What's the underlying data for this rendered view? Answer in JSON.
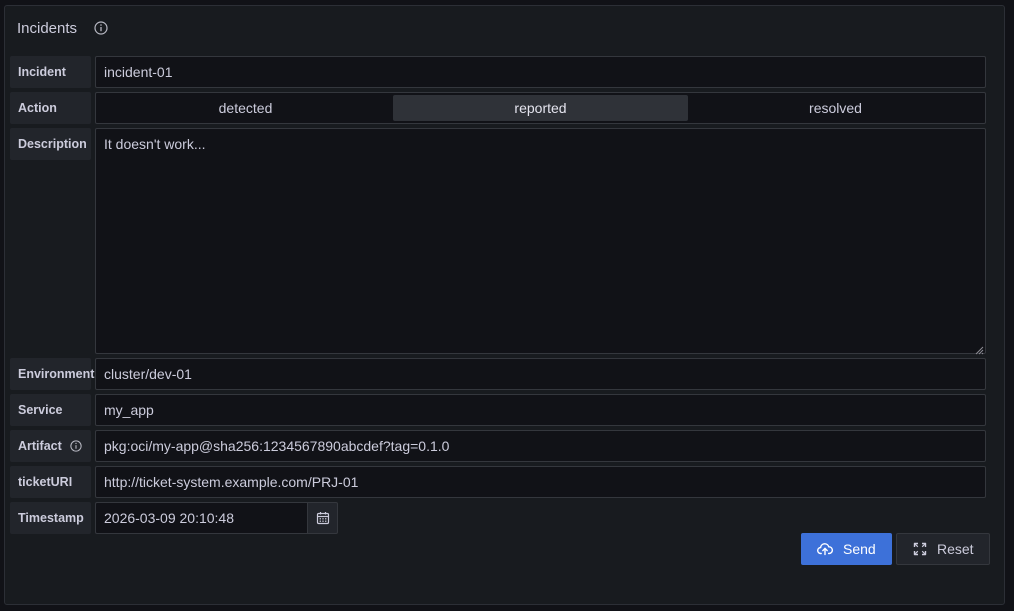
{
  "panel": {
    "title": "Incidents"
  },
  "form": {
    "incident": {
      "label": "Incident",
      "value": "incident-01"
    },
    "action": {
      "label": "Action",
      "options": [
        "detected",
        "reported",
        "resolved"
      ],
      "selected": "reported"
    },
    "description": {
      "label": "Description",
      "value": "It doesn't work..."
    },
    "environment": {
      "label": "Environment",
      "value": "cluster/dev-01"
    },
    "service": {
      "label": "Service",
      "value": "my_app"
    },
    "artifact": {
      "label": "Artifact",
      "value": "pkg:oci/my-app@sha256:1234567890abcdef?tag=0.1.0"
    },
    "ticket_uri": {
      "label": "ticketURI",
      "value": "http://ticket-system.example.com/PRJ-01"
    },
    "timestamp": {
      "label": "Timestamp",
      "value": "2026-03-09 20:10:48"
    }
  },
  "buttons": {
    "send_label": "Send",
    "reset_label": "Reset"
  },
  "colors": {
    "primary": "#3d71d9",
    "background": "#111217",
    "panel": "#181b1f"
  },
  "icons": {
    "title_info": "info-circle-icon",
    "artifact_info": "info-circle-icon",
    "calendar": "calendar-icon",
    "send": "cloud-upload-icon",
    "reset": "expand-arrows-icon"
  }
}
